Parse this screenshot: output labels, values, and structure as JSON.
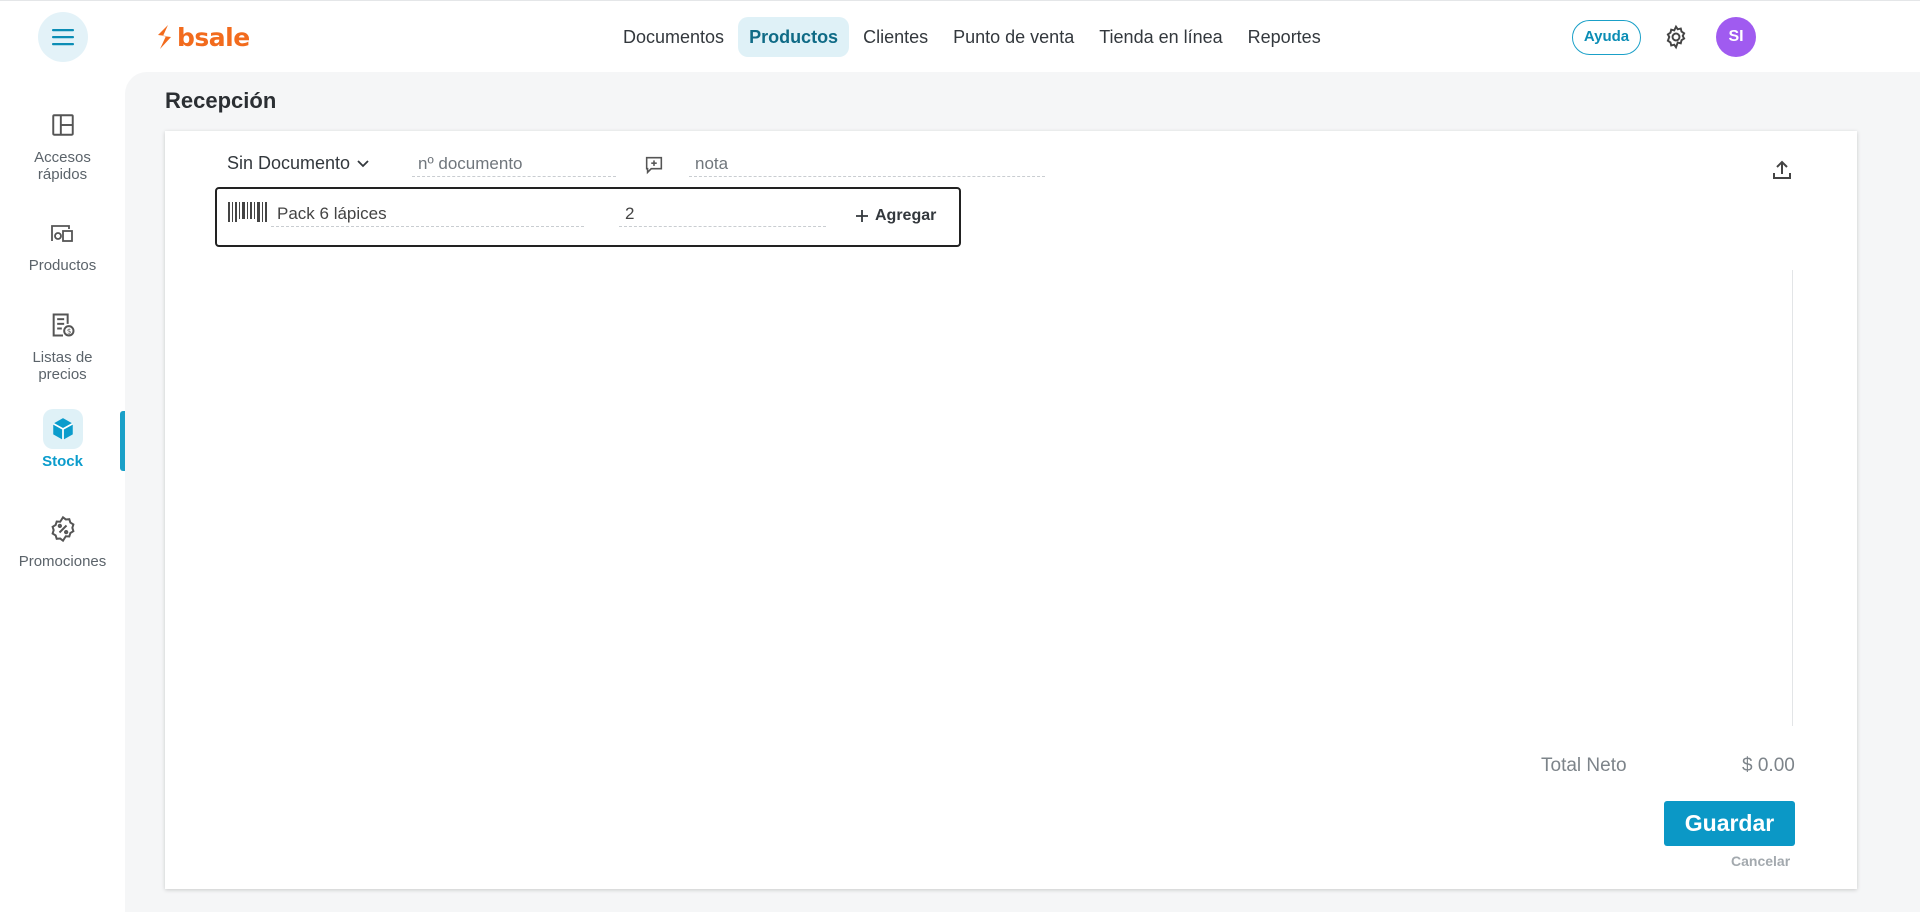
{
  "app": {
    "brand": "bsale",
    "brand_color": "#f26b1d",
    "accent_color": "#0b98c6"
  },
  "nav": {
    "items": [
      {
        "label": "Documentos",
        "active": false
      },
      {
        "label": "Productos",
        "active": true
      },
      {
        "label": "Clientes",
        "active": false
      },
      {
        "label": "Punto de venta",
        "active": false
      },
      {
        "label": "Tienda en línea",
        "active": false
      },
      {
        "label": "Reportes",
        "active": false
      }
    ]
  },
  "header": {
    "help_label": "Ayuda",
    "avatar_initials": "SI",
    "avatar_color": "#a05bf0"
  },
  "sidebar": {
    "items": [
      {
        "label_line1": "Accesos",
        "label_line2": "rápidos",
        "icon": "layout-icon",
        "active": false
      },
      {
        "label_line1": "Productos",
        "label_line2": "",
        "icon": "products-icon",
        "active": false
      },
      {
        "label_line1": "Listas de",
        "label_line2": "precios",
        "icon": "price-list-icon",
        "active": false
      },
      {
        "label_line1": "Stock",
        "label_line2": "",
        "icon": "box-icon",
        "active": true
      },
      {
        "label_line1": "Promociones",
        "label_line2": "",
        "icon": "discount-icon",
        "active": false
      }
    ]
  },
  "page": {
    "title": "Recepción"
  },
  "form": {
    "document_type": "Sin Documento",
    "document_number_placeholder": "nº documento",
    "note_placeholder": "nota",
    "product_value": "Pack 6 lápices",
    "quantity_value": "2",
    "add_label": "Agregar"
  },
  "summary": {
    "total_label": "Total Neto",
    "total_value": "$ 0.00",
    "save_label": "Guardar",
    "cancel_label": "Cancelar"
  }
}
